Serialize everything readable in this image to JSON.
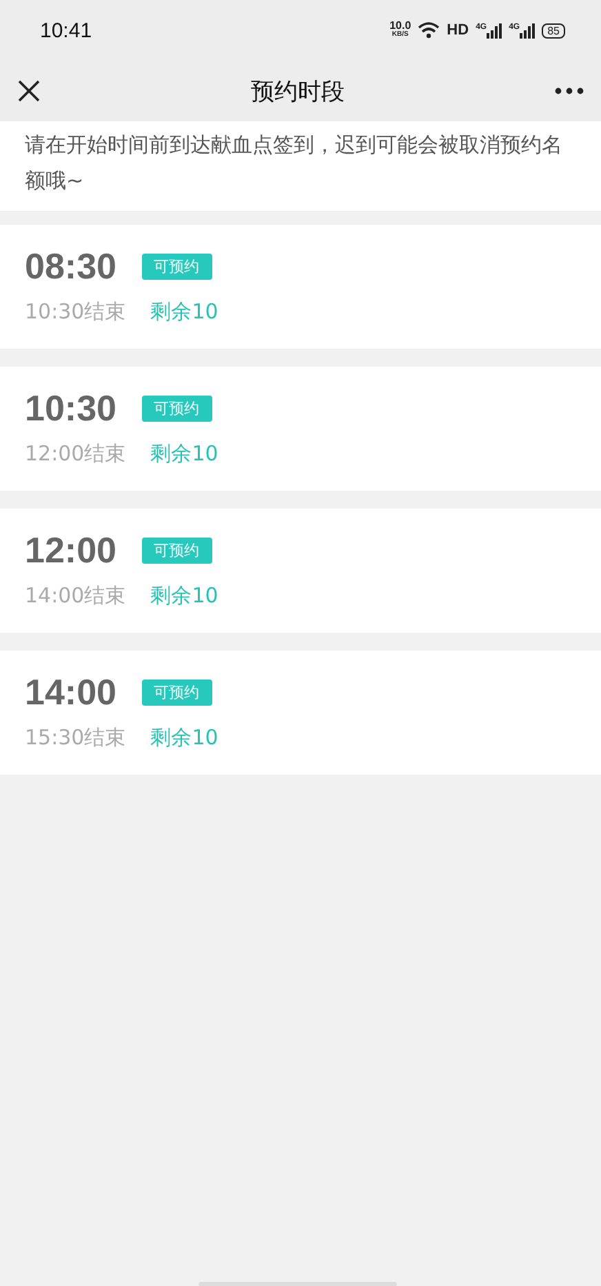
{
  "status_bar": {
    "time": "10:41",
    "net_speed": "10.0",
    "net_unit": "KB/S",
    "hd": "HD",
    "signals": [
      "4G",
      "4G"
    ],
    "battery": "85"
  },
  "nav": {
    "title": "预约时段"
  },
  "notice": "请在开始时间前到达献血点签到，迟到可能会被取消预约名额哦~",
  "slots": [
    {
      "start": "08:30",
      "badge": "可预约",
      "end": "10:30结束",
      "remaining": "剩余10"
    },
    {
      "start": "10:30",
      "badge": "可预约",
      "end": "12:00结束",
      "remaining": "剩余10"
    },
    {
      "start": "12:00",
      "badge": "可预约",
      "end": "14:00结束",
      "remaining": "剩余10"
    },
    {
      "start": "14:00",
      "badge": "可预约",
      "end": "15:30结束",
      "remaining": "剩余10"
    }
  ]
}
